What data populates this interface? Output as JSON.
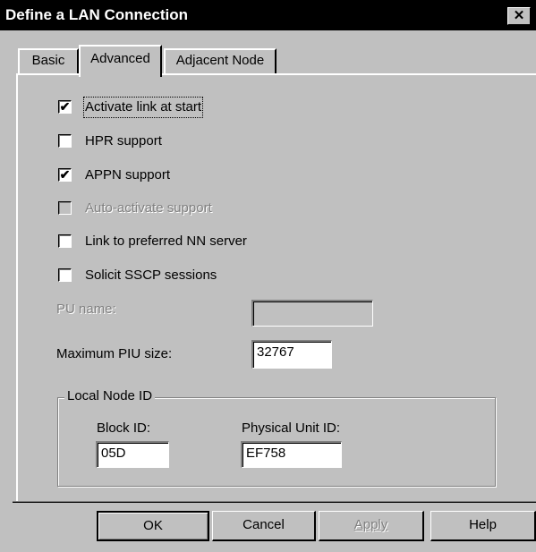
{
  "window": {
    "title": "Define a LAN Connection",
    "close_glyph": "✕"
  },
  "tabs": [
    {
      "label": "Basic",
      "selected": false
    },
    {
      "label": "Advanced",
      "selected": true
    },
    {
      "label": "Adjacent Node",
      "selected": false
    }
  ],
  "options": {
    "activate_link": {
      "label": "Activate link at start",
      "checked": true,
      "enabled": true,
      "mark": "✔"
    },
    "hpr_support": {
      "label": "HPR support",
      "checked": false,
      "enabled": true,
      "mark": ""
    },
    "appn_support": {
      "label": "APPN support",
      "checked": true,
      "enabled": true,
      "mark": "✔"
    },
    "auto_activate": {
      "label": "Auto-activate support",
      "checked": false,
      "enabled": false,
      "mark": ""
    },
    "preferred_nn": {
      "label": "Link to preferred NN server",
      "checked": false,
      "enabled": true,
      "mark": ""
    },
    "solicit_sscp": {
      "label": "Solicit SSCP sessions",
      "checked": false,
      "enabled": true,
      "mark": ""
    }
  },
  "fields": {
    "pu_name": {
      "label": "PU name:",
      "value": "",
      "enabled": false
    },
    "max_piu": {
      "label": "Maximum PIU size:",
      "value": "32767",
      "enabled": true
    }
  },
  "local_node_id": {
    "title": "Local Node ID",
    "block_id": {
      "label": "Block ID:",
      "value": "05D"
    },
    "physical_unit_id": {
      "label": "Physical Unit ID:",
      "value": "EF758"
    }
  },
  "buttons": {
    "ok": "OK",
    "cancel": "Cancel",
    "apply": "Apply",
    "help": "Help"
  },
  "colors": {
    "title_bar": "#000000",
    "face": "#c0c0c0",
    "disabled_text": "#808080"
  }
}
